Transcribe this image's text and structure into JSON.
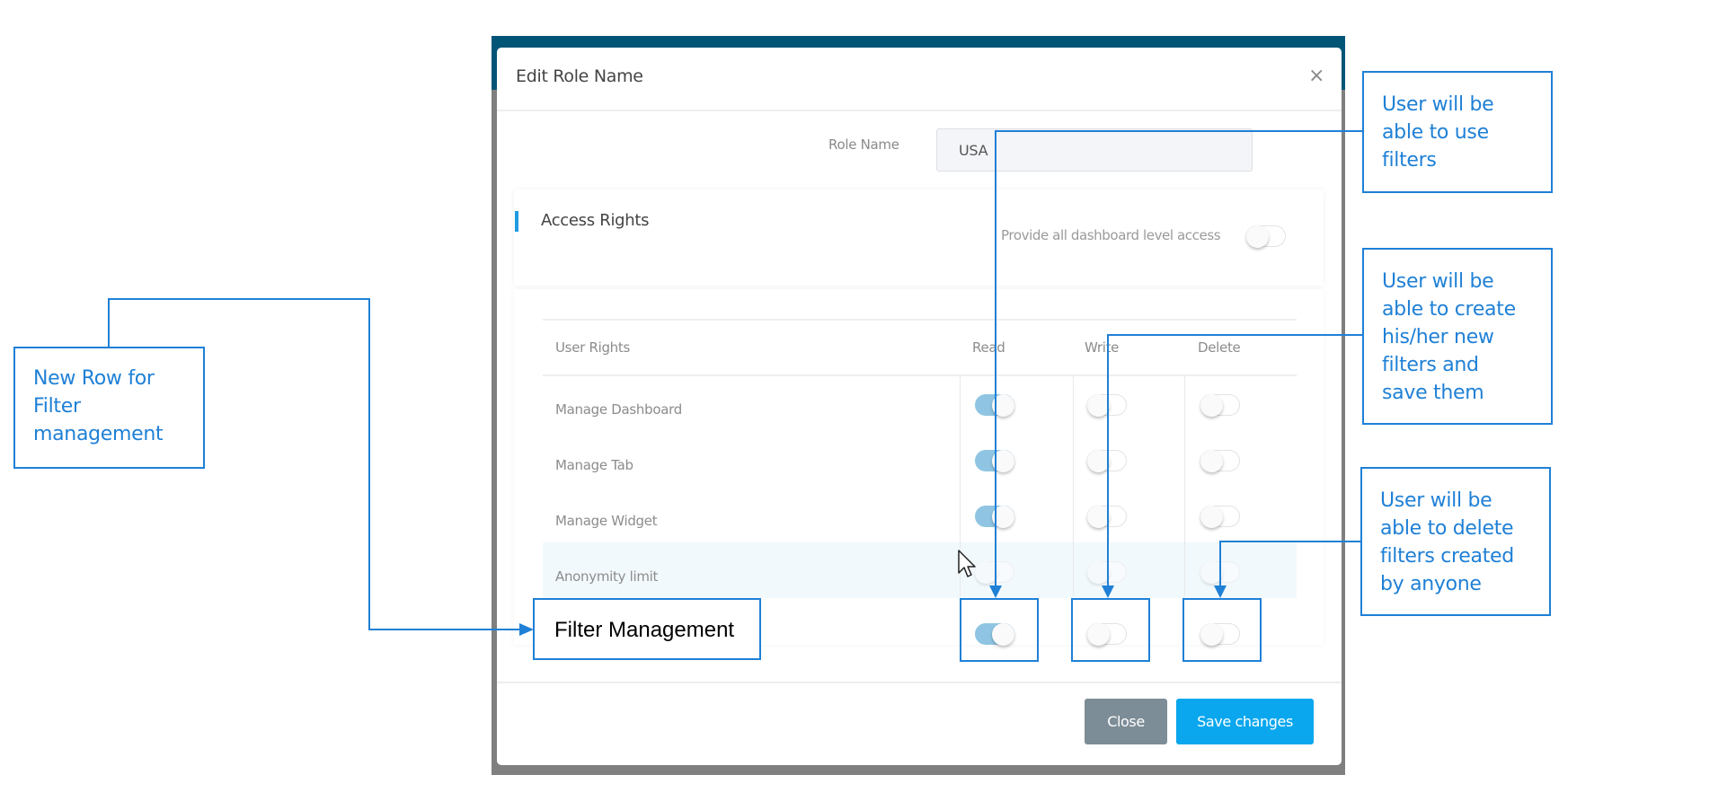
{
  "dialog": {
    "title": "Edit Role Name",
    "close_icon": "×",
    "role_name_label": "Role Name",
    "role_name_value": "USA",
    "section_title": "Access Rights",
    "all_access_label": "Provide all dashboard level access",
    "all_access_on": false,
    "table": {
      "headers": [
        "User Rights",
        "Read",
        "Write",
        "Delete"
      ],
      "rows": [
        {
          "label": "Manage Dashboard",
          "read": true,
          "write": false,
          "delete": false
        },
        {
          "label": "Manage Tab",
          "read": true,
          "write": false,
          "delete": false
        },
        {
          "label": "Manage Widget",
          "read": true,
          "write": false,
          "delete": false
        },
        {
          "label": "Anonymity limit",
          "read": false,
          "write": false,
          "delete": false
        },
        {
          "label": "Filter Management",
          "read": true,
          "write": false,
          "delete": false
        }
      ]
    },
    "buttons": {
      "close": "Close",
      "save": "Save changes"
    }
  },
  "annotations": {
    "new_row": "New Row for\nFilter\nmanagement",
    "read": "User will be\nable to use\nfilters",
    "write": "User will be\nable to create\nhis/her new\nfilters and\nsave them",
    "delete": "User will be\nable to delete\nfilters created\nby anyone"
  },
  "colors": {
    "annotation": "#1f80d6",
    "primary_button": "#0aa7ee",
    "secondary_button": "#7d8d97",
    "toggle_on": "#8fc5e2",
    "header_band": "#005576"
  }
}
